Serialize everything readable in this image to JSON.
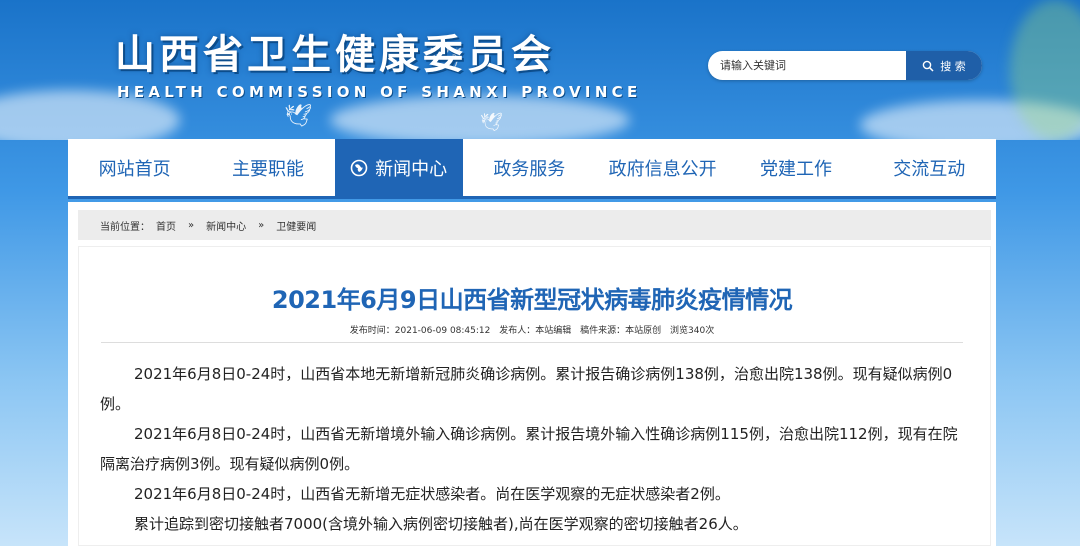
{
  "header": {
    "title": "山西省卫生健康委员会",
    "subtitle": "HEALTH COMMISSION OF SHANXI PROVINCE"
  },
  "search": {
    "placeholder": "请输入关键词",
    "button_label": "搜 索",
    "button_icon": "search-icon"
  },
  "nav": {
    "items": [
      {
        "label": "网站首页"
      },
      {
        "label": "主要职能"
      },
      {
        "label": "新闻中心",
        "active": true,
        "icon": "globe-icon"
      },
      {
        "label": "政务服务"
      },
      {
        "label": "政府信息公开"
      },
      {
        "label": "党建工作"
      },
      {
        "label": "交流互动"
      }
    ]
  },
  "breadcrumb": {
    "prefix": "当前位置：",
    "items": [
      "首页",
      "新闻中心",
      "卫健要闻"
    ],
    "separator": "»"
  },
  "article": {
    "title": "2021年6月9日山西省新型冠状病毒肺炎疫情情况",
    "meta": {
      "published": "发布时间：2021-06-09 08:45:12",
      "publisher": "发布人：本站编辑",
      "source": "稿件来源：本站原创",
      "views": "浏览340次"
    },
    "paragraphs": [
      "2021年6月8日0-24时，山西省本地无新增新冠肺炎确诊病例。累计报告确诊病例138例，治愈出院138例。现有疑似病例0例。",
      "2021年6月8日0-24时，山西省无新增境外输入确诊病例。累计报告境外输入性确诊病例115例，治愈出院112例，现有在院隔离治疗病例3例。现有疑似病例0例。",
      "2021年6月8日0-24时，山西省无新增无症状感染者。尚在医学观察的无症状感染者2例。",
      "累计追踪到密切接触者7000(含境外输入病例密切接触者),尚在医学观察的密切接触者26人。"
    ]
  },
  "colors": {
    "primary": "#1f65b5",
    "header_dark": "#1a73c9",
    "breadcrumb_bg": "#ececec"
  }
}
